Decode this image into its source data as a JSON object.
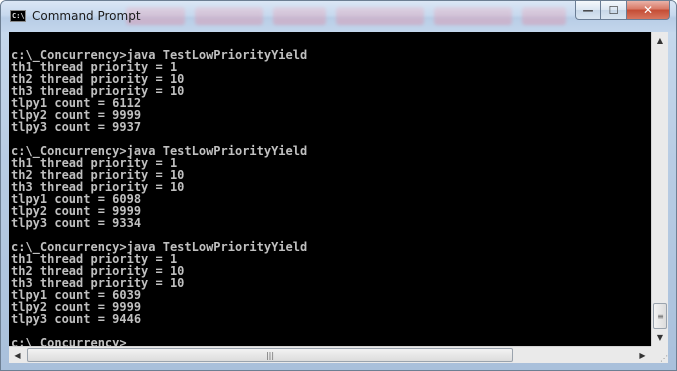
{
  "window": {
    "title": "Command Prompt",
    "icon": "console-icon",
    "icon_glyph": "C:\\"
  },
  "caption_buttons": {
    "minimize_glyph": "—",
    "maximize_glyph": "☐",
    "close_glyph": "✕"
  },
  "console": {
    "background": "#000000",
    "foreground": "#c0c0c0",
    "lines": [
      "",
      "c:\\_Concurrency>java TestLowPriorityYield",
      "th1 thread priority = 1",
      "th2 thread priority = 10",
      "th3 thread priority = 10",
      "tlpy1 count = 6112",
      "tlpy2 count = 9999",
      "tlpy3 count = 9937",
      "",
      "c:\\_Concurrency>java TestLowPriorityYield",
      "th1 thread priority = 1",
      "th2 thread priority = 10",
      "th3 thread priority = 10",
      "tlpy1 count = 6098",
      "tlpy2 count = 9999",
      "tlpy3 count = 9334",
      "",
      "c:\\_Concurrency>java TestLowPriorityYield",
      "th1 thread priority = 1",
      "th2 thread priority = 10",
      "th3 thread priority = 10",
      "tlpy1 count = 6039",
      "tlpy2 count = 9999",
      "tlpy3 count = 9446",
      "",
      "c:\\_Concurrency>"
    ]
  },
  "scrollbars": {
    "up_glyph": "▲",
    "down_glyph": "▼",
    "left_glyph": "◀",
    "right_glyph": "▶",
    "v_thumb_grip": "≡",
    "h_thumb_grip": "|||",
    "size_grip": "⋰"
  }
}
